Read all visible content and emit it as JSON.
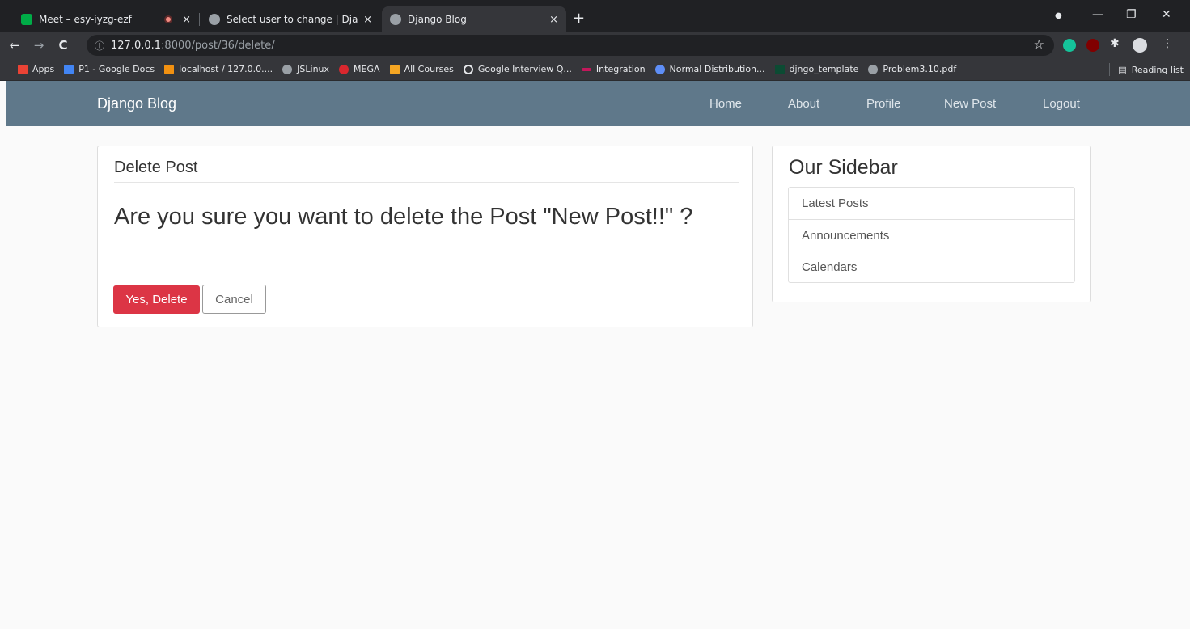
{
  "browser": {
    "tabs": [
      {
        "title": "Meet – esy-iyzg-ezf",
        "favicon_color": "#00ac47"
      },
      {
        "title": "Select user to change | Django si",
        "favicon_color": "#9aa0a6"
      },
      {
        "title": "Django Blog",
        "favicon_color": "#9aa0a6"
      }
    ],
    "new_tab": "+",
    "close": "×",
    "window_controls": {
      "minimize": "—",
      "restore": "❐",
      "close": "✕"
    },
    "nav": {
      "back": "←",
      "forward": "→",
      "reload": "C"
    },
    "address": {
      "info": "ⓘ",
      "host": "127.0.0.1",
      "path": ":8000/post/36/delete/",
      "star": "☆"
    },
    "bookmarks": [
      {
        "label": "Apps",
        "color": "#ea4335"
      },
      {
        "label": "P1 - Google Docs",
        "color": "#4285f4"
      },
      {
        "label": "localhost / 127.0.0....",
        "color": "#f29111"
      },
      {
        "label": "JSLinux",
        "color": "#9aa0a6"
      },
      {
        "label": "MEGA",
        "color": "#d9272e"
      },
      {
        "label": "All Courses",
        "color": "#f5a623"
      },
      {
        "label": "Google Interview Q...",
        "color": "#202124"
      },
      {
        "label": "Integration",
        "color": "#c2185b"
      },
      {
        "label": "Normal Distribution...",
        "color": "#5e8ef7"
      },
      {
        "label": "djngo_template",
        "color": "#0c4b33"
      },
      {
        "label": "Problem3.10.pdf",
        "color": "#9aa0a6"
      }
    ],
    "reading_list": "Reading list"
  },
  "site": {
    "brand": "Django Blog",
    "nav": {
      "home": "Home",
      "about": "About",
      "profile": "Profile",
      "new_post": "New Post",
      "logout": "Logout"
    }
  },
  "main": {
    "legend": "Delete Post",
    "confirm_text": "Are you sure you want to delete the Post \"New Post!!\" ?",
    "delete_button": "Yes, Delete",
    "cancel_button": "Cancel"
  },
  "sidebar": {
    "title": "Our Sidebar",
    "items": [
      "Latest Posts",
      "Announcements",
      "Calendars"
    ]
  },
  "colors": {
    "navbar": "#5f788a",
    "danger": "#dc3545",
    "background": "#fafafa"
  }
}
